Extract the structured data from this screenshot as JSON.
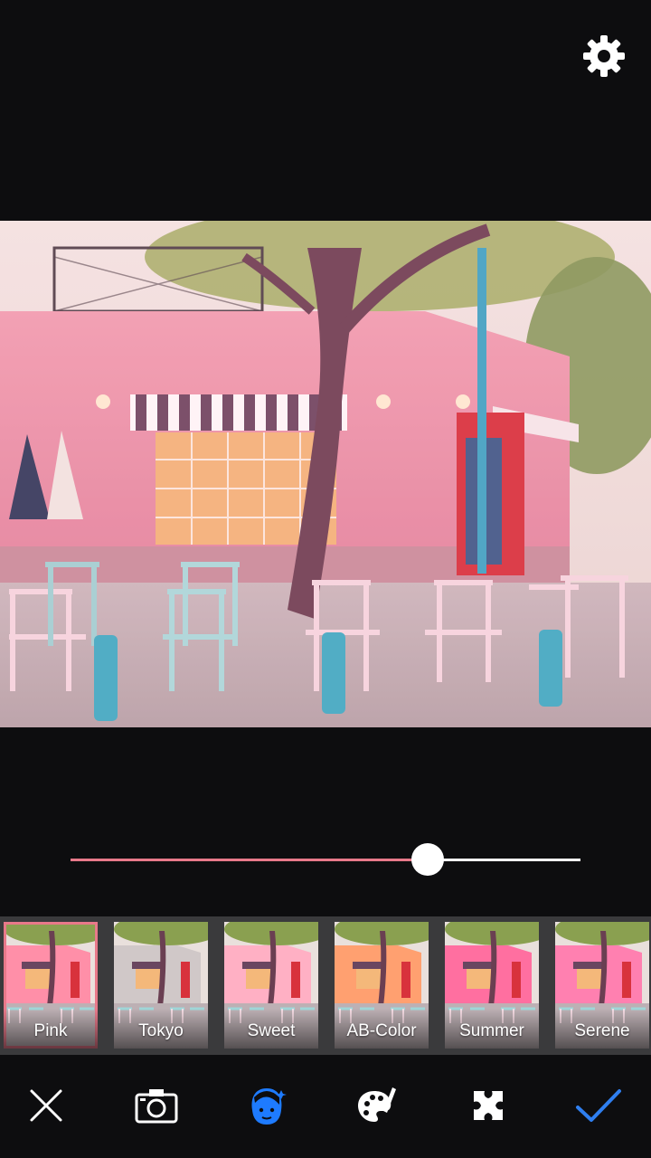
{
  "colors": {
    "background": "#0d0d0f",
    "accent": "#e8798a",
    "active_tool": "#1e7bff",
    "confirm": "#2f7ff0",
    "strip": "#3a3a3c"
  },
  "slider": {
    "value": 0.7
  },
  "filters": {
    "selected_index": 0,
    "items": [
      {
        "label": "Pink",
        "tint": "#ff8fa8"
      },
      {
        "label": "Tokyo",
        "tint": "#d0c8c8"
      },
      {
        "label": "Sweet",
        "tint": "#ffb0c4"
      },
      {
        "label": "AB-Color",
        "tint": "#ffa070"
      },
      {
        "label": "Summer",
        "tint": "#ff6fa0"
      },
      {
        "label": "Serene",
        "tint": "#ff80b0"
      }
    ]
  },
  "toolbar": {
    "tools": [
      {
        "icon": "close-icon"
      },
      {
        "icon": "camera-icon"
      },
      {
        "icon": "face-retouch-icon",
        "active": true
      },
      {
        "icon": "palette-icon"
      },
      {
        "icon": "frame-icon"
      },
      {
        "icon": "checkmark-icon"
      }
    ]
  },
  "header": {
    "settings_icon": "gear-icon"
  }
}
